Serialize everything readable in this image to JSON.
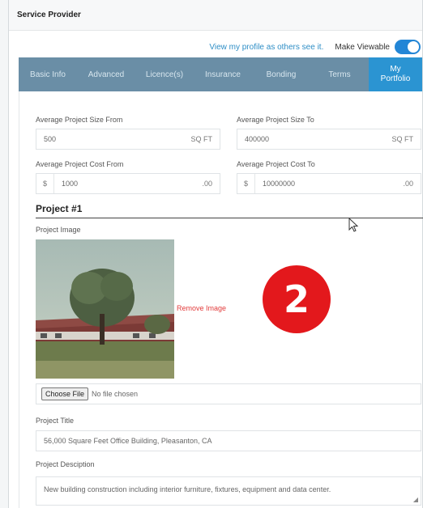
{
  "panel": {
    "title": "Service Provider"
  },
  "profile": {
    "view_link": "View my profile as others see it.",
    "make_viewable_label": "Make Viewable",
    "make_viewable_on": true
  },
  "tabs": [
    {
      "label": "Basic Info",
      "active": false
    },
    {
      "label": "Advanced",
      "active": false
    },
    {
      "label": "Licence(s)",
      "active": false
    },
    {
      "label": "Insurance",
      "active": false
    },
    {
      "label": "Bonding",
      "active": false
    },
    {
      "label": "Terms",
      "active": false
    },
    {
      "label_line1": "My",
      "label_line2": "Portfolio",
      "active": true
    }
  ],
  "size": {
    "from_label": "Average Project Size From",
    "from_value": "500",
    "from_unit": "SQ FT",
    "to_label": "Average Project Size To",
    "to_value": "400000",
    "to_unit": "SQ FT"
  },
  "cost": {
    "from_label": "Average Project Cost From",
    "from_prefix": "$",
    "from_value": "1000",
    "from_suffix": ".00",
    "to_label": "Average Project Cost To",
    "to_prefix": "$",
    "to_value": "10000000",
    "to_suffix": ".00"
  },
  "project": {
    "heading": "Project #1",
    "image_label": "Project Image",
    "remove_image": "Remove Image",
    "choose_file": "Choose File",
    "no_file": "No file chosen",
    "title_label": "Project Title",
    "title_value": "56,000 Square Feet Office Building, Pleasanton, CA",
    "desc_label": "Project Desciption",
    "desc_value": "New building construction including interior furniture, fixtures, equipment and data center."
  },
  "badge": {
    "number": "2"
  },
  "colors": {
    "accent": "#2b94d2",
    "tabs_bg": "#6a8ea6",
    "badge": "#e3181c",
    "remove_link": "#e23c3c"
  }
}
